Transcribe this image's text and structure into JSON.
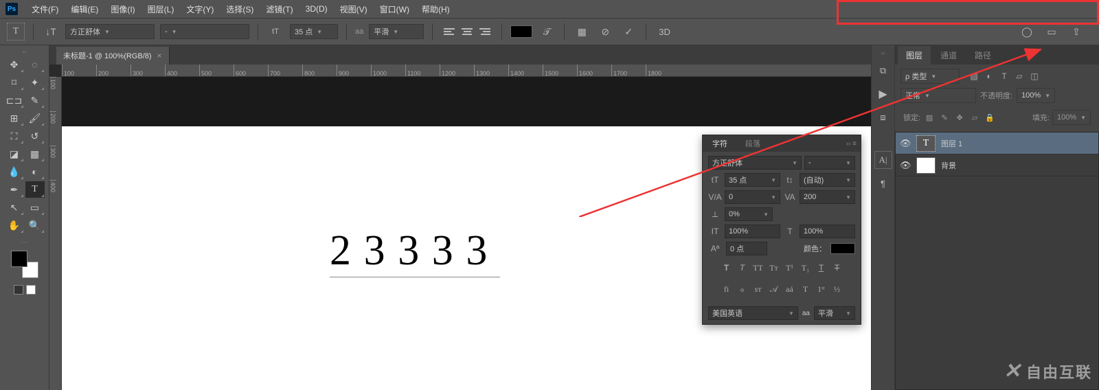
{
  "menubar": {
    "items": [
      "文件(F)",
      "编辑(E)",
      "图像(I)",
      "图层(L)",
      "文字(Y)",
      "选择(S)",
      "滤镜(T)",
      "3D(D)",
      "视图(V)",
      "窗口(W)",
      "帮助(H)"
    ]
  },
  "optbar": {
    "font_family": "方正舒体",
    "font_style": "-",
    "font_size": "35 点",
    "aa_label": "aa",
    "aa_mode": "平滑",
    "threed": "3D"
  },
  "tab": {
    "title": "未标题-1 @ 100%(RGB/8)"
  },
  "ruler": {
    "ticks": [
      "100",
      "200",
      "300",
      "400",
      "500",
      "600",
      "700",
      "800",
      "900",
      "1000",
      "1100",
      "1200",
      "1300",
      "1400",
      "1500",
      "1600",
      "1700",
      "1800"
    ]
  },
  "ruler_v": {
    "ticks": [
      "100",
      "200",
      "300",
      "400"
    ]
  },
  "canvas_text": "23333",
  "char_panel": {
    "tab1": "字符",
    "tab2": "段落",
    "font_family": "方正舒体",
    "font_style": "-",
    "size": "35 点",
    "leading": "(自动)",
    "va": "0",
    "tracking": "200",
    "scale": "0%",
    "vscale": "100%",
    "hscale": "100%",
    "baseline": "0 点",
    "color_label": "颜色：",
    "lang": "美国英语",
    "aa": "aa",
    "aa_mode": "平滑"
  },
  "layers_panel": {
    "tabs": [
      "图层",
      "通道",
      "路径"
    ],
    "kind": "ρ 类型",
    "blend": "正常",
    "opacity_label": "不透明度:",
    "opacity": "100%",
    "lock_label": "锁定:",
    "fill_label": "填充:",
    "fill": "100%",
    "layers": [
      {
        "name": "图层 1",
        "type": "text"
      },
      {
        "name": "背景",
        "type": "bg"
      }
    ]
  },
  "watermark": "自由互联"
}
